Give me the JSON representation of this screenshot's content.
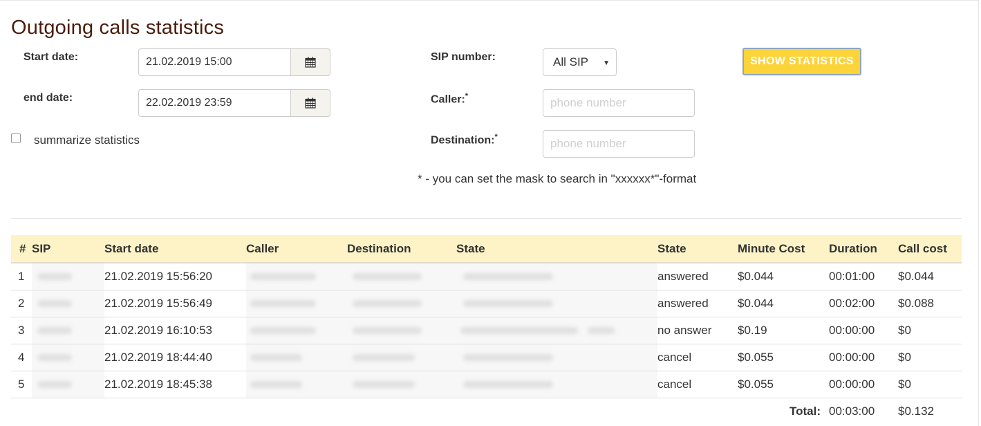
{
  "page": {
    "title": "Outgoing calls statistics"
  },
  "filters": {
    "start_label": "Start date:",
    "start_value": "21.02.2019 15:00",
    "end_label": "end date:",
    "end_value": "22.02.2019 23:59",
    "summarize_label": "summarize statistics",
    "sip_label": "SIP number:",
    "sip_value": "All SIP",
    "caller_label": "Caller:",
    "caller_placeholder": "phone number",
    "destination_label": "Destination:",
    "destination_placeholder": "phone number",
    "asterisk": "*",
    "mask_hint": "* - you can set the mask to search in \"xxxxxx*\"-format",
    "show_button": "SHOW STATISTICS"
  },
  "table": {
    "headers": [
      "#",
      "SIP",
      "Start date",
      "Caller",
      "Destination",
      "State",
      "State",
      "Minute Cost",
      "Duration",
      "Call cost"
    ],
    "rows": [
      {
        "num": "1",
        "start": "21.02.2019 15:56:20",
        "state": "answered",
        "minute_cost": "$0.044",
        "duration": "00:01:00",
        "call_cost": "$0.044"
      },
      {
        "num": "2",
        "start": "21.02.2019 15:56:49",
        "state": "answered",
        "minute_cost": "$0.044",
        "duration": "00:02:00",
        "call_cost": "$0.088"
      },
      {
        "num": "3",
        "start": "21.02.2019 16:10:53",
        "state": "no answer",
        "minute_cost": "$0.19",
        "duration": "00:00:00",
        "call_cost": "$0"
      },
      {
        "num": "4",
        "start": "21.02.2019 18:44:40",
        "state": "cancel",
        "minute_cost": "$0.055",
        "duration": "00:00:00",
        "call_cost": "$0"
      },
      {
        "num": "5",
        "start": "21.02.2019 18:45:38",
        "state": "cancel",
        "minute_cost": "$0.055",
        "duration": "00:00:00",
        "call_cost": "$0"
      }
    ],
    "total_label": "Total:",
    "total_duration": "00:03:00",
    "total_cost": "$0.132"
  },
  "colors": {
    "accent_button": "#fdd33a",
    "header_row": "#fdf3c7",
    "title": "#4a1c0c"
  },
  "icons": {
    "calendar": "calendar-icon",
    "dropdown": "triangle-down-icon"
  }
}
